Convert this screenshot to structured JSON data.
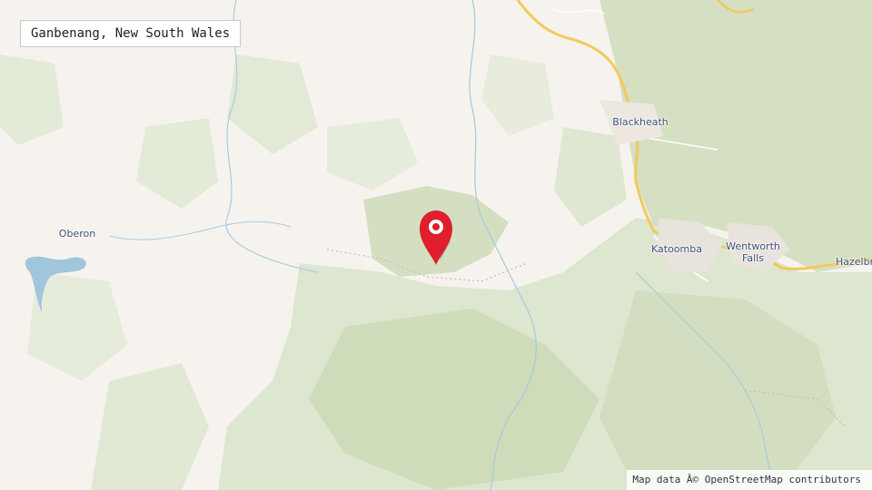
{
  "location_label": "Ganbenang, New South Wales",
  "places": {
    "oberon": "Oberon",
    "blackheath": "Blackheath",
    "katoomba": "Katoomba",
    "wentworth_falls_line1": "Wentworth",
    "wentworth_falls_line2": "Falls",
    "hazelbrook": "Hazelbr"
  },
  "attribution": "Map data Â© OpenStreetMap contributors",
  "colors": {
    "land": "#f6f3ee",
    "park": "#dfe7d2",
    "forest": "#cfdcbc",
    "water": "#9fc6dc",
    "road": "#f4cf6b",
    "marker": "#e01e2e"
  },
  "marker_icon": "map-pin-icon"
}
